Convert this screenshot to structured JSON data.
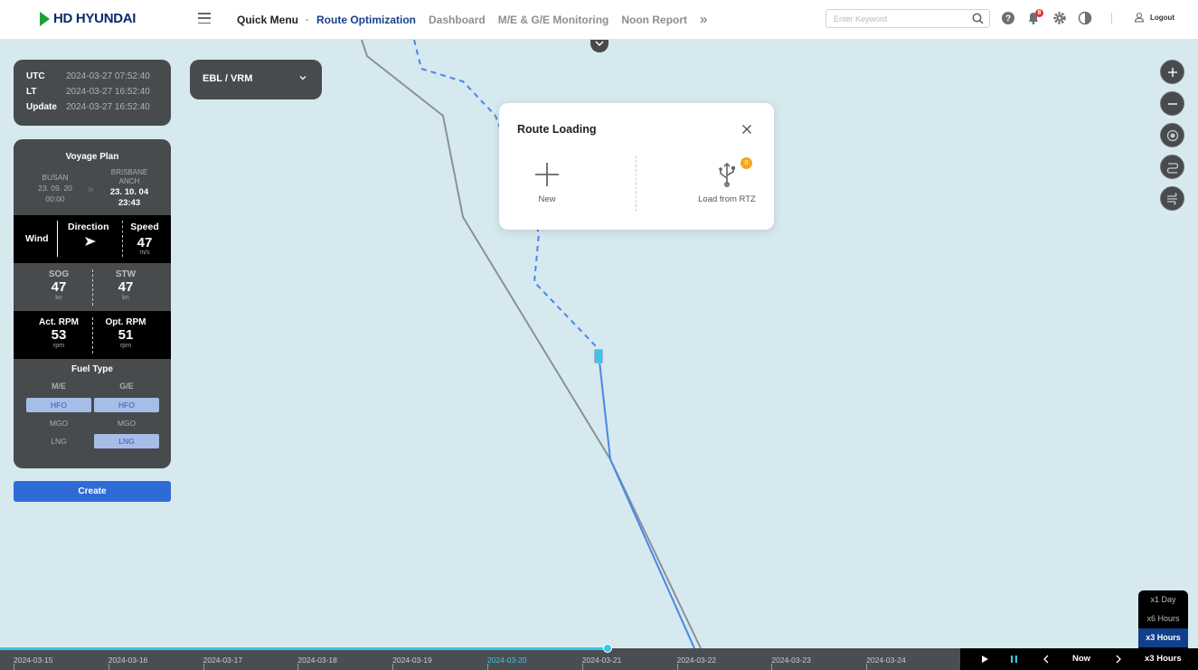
{
  "header": {
    "brand": "HD HYUNDAI",
    "nav": {
      "quick_menu": "Quick Menu",
      "separator": "·",
      "route_optimization": "Route Optimization",
      "dashboard": "Dashboard",
      "monitoring": "M/E & G/E Monitoring",
      "noon_report": "Noon Report",
      "more": "»"
    },
    "search_placeholder": "Enter Keyword",
    "notification_count": "8",
    "logout": "Logout"
  },
  "time_panel": {
    "utc_label": "UTC",
    "utc_value": "2024-03-27 07:52:40",
    "lt_label": "LT",
    "lt_value": "2024-03-27 16:52:40",
    "update_label": "Update",
    "update_value": "2024-03-27 16:52:40"
  },
  "ebl": {
    "label": "EBL / VRM"
  },
  "voyage": {
    "title": "Voyage Plan",
    "from_port": "BUSAN",
    "from_date": "23. 09. 20",
    "from_time": "00:00",
    "to_port_line1": "BRISBANE",
    "to_port_line2": "ANCH",
    "to_date": "23. 10. 04",
    "to_time": "23:43",
    "wind_label": "Wind",
    "direction_label": "Direction",
    "direction_icon": "arrow-right-icon",
    "speed_label": "Speed",
    "speed_value": "47",
    "speed_unit": "m/s",
    "sog_label": "SOG",
    "sog_value": "47",
    "sog_unit": "kn",
    "stw_label": "STW",
    "stw_value": "47",
    "stw_unit": "kn",
    "act_rpm_label": "Act. RPM",
    "act_rpm_value": "53",
    "act_rpm_unit": "rpm",
    "opt_rpm_label": "Opt. RPM",
    "opt_rpm_value": "51",
    "opt_rpm_unit": "rpm",
    "fuel_title": "Fuel Type",
    "me_label": "M/E",
    "ge_label": "G/E",
    "me_hfo": "HFO",
    "me_mgo": "MGO",
    "me_lng": "LNG",
    "ge_hfo": "HFO",
    "ge_mgo": "MGO",
    "ge_lng": "LNG",
    "create": "Create"
  },
  "dialog": {
    "title": "Route Loading",
    "new_label": "New",
    "rtz_label": "Load from RTZ",
    "rtz_badge": "0"
  },
  "speed_menu": {
    "opt1": "x1 Day",
    "opt2": "x6 Hours",
    "opt3": "x3 Hours"
  },
  "timeline": {
    "dates": [
      "2024-03-15",
      "2024-03-16",
      "2024-03-17",
      "2024-03-18",
      "2024-03-19",
      "2024-03-20",
      "2024-03-21",
      "2024-03-22",
      "2024-03-23",
      "2024-03-24"
    ],
    "current_date": "2024-03-20",
    "now_label": "Now",
    "speed_label": "x3 Hours"
  },
  "colors": {
    "panel": "#474b4d",
    "accent": "#2e6bd6",
    "brand_blue": "#0b2a6b",
    "brand_green": "#1aa23a",
    "timeline_progress": "#38c7e6",
    "route_solid": "#4a86e8",
    "route_grey": "#8a9296"
  }
}
